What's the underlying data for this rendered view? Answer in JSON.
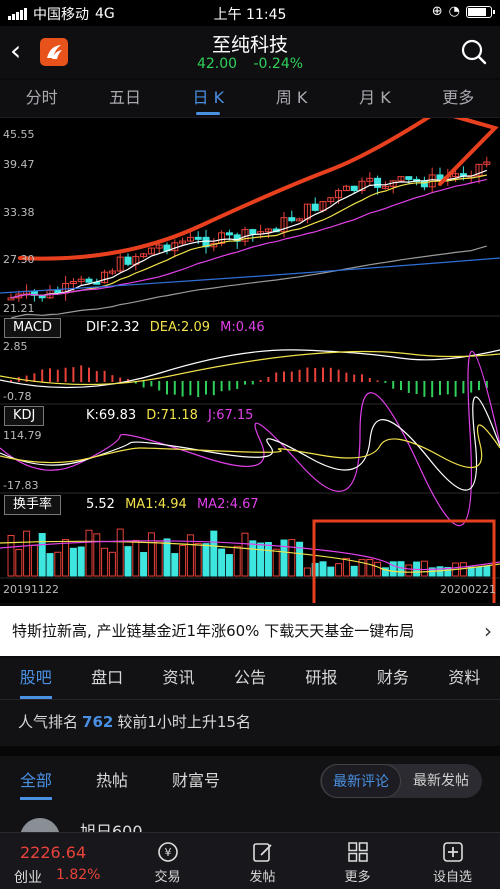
{
  "status_bar": {
    "carrier": "中国移动",
    "network": "4G",
    "time": "上午 11:45"
  },
  "header": {
    "title": "至纯科技",
    "price": "42.00",
    "change": "-0.24%"
  },
  "period_tabs": [
    "分时",
    "五日",
    "日 K",
    "周 K",
    "月 K",
    "更多"
  ],
  "active_period": "日 K",
  "main_chart": {
    "axis_labels": [
      "45.55",
      "39.47",
      "33.38",
      "27.30",
      "21.21"
    ],
    "date_start": "20191122",
    "date_end": "20200221"
  },
  "macd": {
    "label": "MACD",
    "dif": "DIF:2.32",
    "dea": "DEA:2.09",
    "m": "M:0.46",
    "axis_top": "2.85",
    "axis_bottom": "-0.78"
  },
  "kdj": {
    "label": "KDJ",
    "k": "K:69.83",
    "d": "D:71.18",
    "j": "J:67.15",
    "axis_top": "114.79",
    "axis_bottom": "-17.83"
  },
  "turnover": {
    "label": "换手率",
    "value": "5.52",
    "ma1": "MA1:4.94",
    "ma2": "MA2:4.67"
  },
  "promo": {
    "text": "特斯拉新高, 产业链基金近1年涨60%  下载天天基金一键布局",
    "arrow": "›"
  },
  "info_tabs": [
    "股吧",
    "盘口",
    "资讯",
    "公告",
    "研报",
    "财务",
    "资料"
  ],
  "active_info_tab": "股吧",
  "rank": {
    "prefix": "人气排名",
    "number": "762",
    "suffix": "较前1小时上升15名"
  },
  "feed_tabs": [
    "全部",
    "热帖",
    "财富号"
  ],
  "sort_toggle": {
    "on": "最新评论",
    "off": "最新发帖"
  },
  "post": {
    "author": "旭日600"
  },
  "bottom_bar": {
    "index_value": "2226.64",
    "index_name": "创业",
    "index_change": "1.82%",
    "items": [
      "交易",
      "发帖",
      "更多",
      "设自选"
    ]
  },
  "colors": {
    "accent": "#4a90e2",
    "up": "#e8423a",
    "down": "#2fd15a",
    "annotation": "#e8401e",
    "cyan_candle": "#3ee6e0"
  }
}
